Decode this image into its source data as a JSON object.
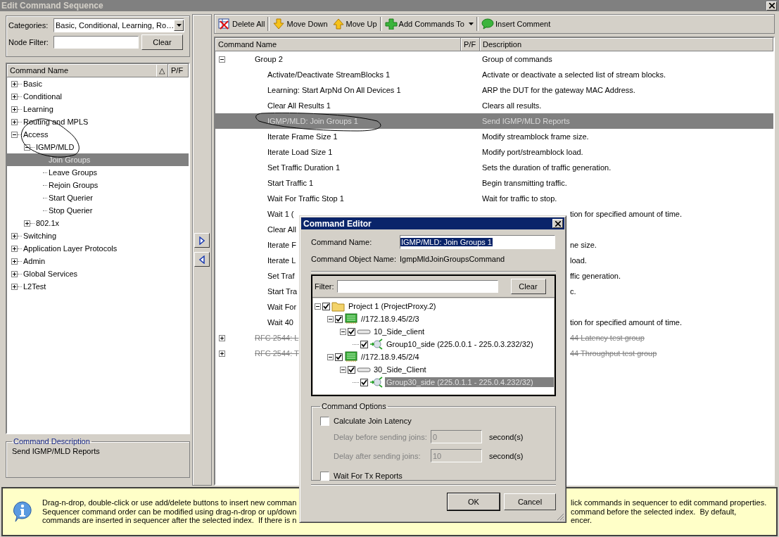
{
  "window": {
    "title": "Edit Command Sequence"
  },
  "filters": {
    "categories_label": "Categories:",
    "categories_value": "Basic, Conditional, Learning, Ro…",
    "node_filter_label": "Node Filter:",
    "clear": "Clear"
  },
  "command_tree": {
    "columns": [
      "Command Name",
      "P/F"
    ],
    "sort_mark": "△",
    "items": [
      {
        "label": "Basic",
        "kind": "group",
        "expanded": false,
        "selected": false
      },
      {
        "label": "Conditional",
        "kind": "group",
        "expanded": false,
        "selected": false
      },
      {
        "label": "Learning",
        "kind": "group",
        "expanded": false,
        "selected": false
      },
      {
        "label": "Routing and MPLS",
        "kind": "group",
        "expanded": false,
        "selected": false
      },
      {
        "label": "Access",
        "kind": "group",
        "expanded": true,
        "selected": false,
        "children": [
          {
            "label": "IGMP/MLD",
            "kind": "group",
            "expanded": true,
            "selected": false,
            "children": [
              {
                "label": "Join Groups",
                "kind": "command",
                "selected": true
              },
              {
                "label": "Leave Groups",
                "kind": "command",
                "selected": false
              },
              {
                "label": "Rejoin Groups",
                "kind": "command",
                "selected": false
              },
              {
                "label": "Start Querier",
                "kind": "command",
                "selected": false
              },
              {
                "label": "Stop Querier",
                "kind": "command",
                "selected": false
              }
            ]
          },
          {
            "label": "802.1x",
            "kind": "group",
            "expanded": false,
            "selected": false
          }
        ]
      },
      {
        "label": "Switching",
        "kind": "group",
        "expanded": false,
        "selected": false
      },
      {
        "label": "Application Layer Protocols",
        "kind": "group",
        "expanded": false,
        "selected": false
      },
      {
        "label": "Admin",
        "kind": "group",
        "expanded": false,
        "selected": false
      },
      {
        "label": "Global Services",
        "kind": "group",
        "expanded": false,
        "selected": false
      },
      {
        "label": "L2Test",
        "kind": "group",
        "expanded": false,
        "selected": false
      }
    ]
  },
  "command_description": {
    "title": "Command Description",
    "text": "Send IGMP/MLD Reports"
  },
  "toolbar": [
    {
      "label": "Delete All",
      "kind": "delete",
      "dropdown": false
    },
    {
      "label": "Move Down",
      "kind": "down",
      "dropdown": false
    },
    {
      "label": "Move Up",
      "kind": "up",
      "dropdown": false
    },
    {
      "label": "Add Commands To",
      "kind": "add",
      "dropdown": true
    },
    {
      "label": "Insert Comment",
      "kind": "comment",
      "dropdown": false
    }
  ],
  "sequence": {
    "columns": [
      "Command Name",
      "P/F",
      "Description"
    ],
    "rows": [
      {
        "name": "Group 2",
        "description": "Group of commands",
        "kind": "full",
        "expanded": true,
        "disabled": false,
        "selected": false,
        "children": [
          {
            "name": "Activate/Deactivate StreamBlocks 1",
            "description": "Activate or deactivate a selected list of stream blocks.",
            "kind": "full",
            "selected": false
          },
          {
            "name": "Learning: Start ArpNd On All Devices 1",
            "description": "ARP the DUT for the gateway MAC Address.",
            "kind": "full",
            "selected": false
          },
          {
            "name": "Clear All Results 1",
            "description": "Clears all results.",
            "kind": "full",
            "selected": false
          },
          {
            "name": "IGMP/MLD: Join Groups 1",
            "description": "Send IGMP/MLD Reports",
            "kind": "full",
            "selected": true
          },
          {
            "name": "Iterate Frame Size 1",
            "description": "Modify streamblock frame size.",
            "kind": "full",
            "selected": false
          },
          {
            "name": "Iterate Load Size 1",
            "description": "Modify port/streamblock load.",
            "kind": "full",
            "selected": false
          },
          {
            "name": "Set Traffic Duration 1",
            "description": "Sets the duration of traffic generation.",
            "kind": "full",
            "selected": false
          },
          {
            "name": "Start Traffic 1",
            "description": "Begin transmitting traffic.",
            "kind": "full",
            "selected": false
          },
          {
            "name": "Wait For Traffic Stop 1",
            "description": "Wait for traffic to stop.",
            "kind": "full",
            "selected": false
          },
          {
            "name": "Wait 1 (",
            "description": "tion for specified amount of time.",
            "kind": "clipped",
            "selected": false
          },
          {
            "name": "Clear All",
            "kind": "clipped",
            "selected": false
          },
          {
            "name": "Iterate F",
            "description": "ne size.",
            "kind": "clipped",
            "selected": false
          },
          {
            "name": "Iterate L",
            "description": "load.",
            "kind": "clipped",
            "selected": false
          },
          {
            "name": "Set Traf",
            "description": "ffic generation.",
            "kind": "clipped",
            "selected": false
          },
          {
            "name": "Start Tra",
            "description": "c.",
            "kind": "clipped",
            "selected": false
          },
          {
            "name": "Wait For",
            "kind": "clipped",
            "selected": false
          },
          {
            "name": "Wait 40",
            "description": "tion for specified amount of time.",
            "kind": "clipped",
            "selected": false
          }
        ]
      },
      {
        "name": "RFC 2544: L",
        "description": "44 Latency test group",
        "kind": "clipped",
        "expanded": false,
        "disabled": true,
        "selected": false
      },
      {
        "name": "RFC 2544: T",
        "description": "44 Throughput test group",
        "kind": "clipped",
        "expanded": false,
        "disabled": true,
        "selected": false
      }
    ]
  },
  "info": {
    "lines_left": [
      "Drag-n-drop, double-click or use add/delete buttons to insert new comman",
      "Sequencer command order can be modified using drag-n-drop or up/down",
      "commands are inserted in sequencer after the selected index.  If there is n"
    ],
    "lines_right": [
      "lick commands in sequencer to edit command properties.",
      "command before the selected index.  By default,",
      "encer."
    ]
  },
  "dialog": {
    "title": "Command Editor",
    "name_label": "Command Name:",
    "name_value": "IGMP/MLD: Join Groups 1",
    "object_label": "Command Object Name:",
    "object_value": "IgmpMldJoinGroupsCommand",
    "filter_label": "Filter:",
    "clear": "Clear",
    "tree": [
      {
        "label": "Project 1 (ProjectProxy.2)",
        "kind": "project",
        "checked": true,
        "expanded": true,
        "selected": false,
        "children": [
          {
            "label": "//172.18.9.45/2/3",
            "kind": "port",
            "checked": true,
            "expanded": true,
            "selected": false,
            "children": [
              {
                "label": "10_Side_client",
                "kind": "device",
                "checked": true,
                "expanded": true,
                "selected": false,
                "children": [
                  {
                    "label": "Group10_side (225.0.0.1 - 225.0.3.232/32)",
                    "kind": "group",
                    "checked": true,
                    "selected": false
                  }
                ]
              }
            ]
          },
          {
            "label": "//172.18.9.45/2/4",
            "kind": "port",
            "checked": true,
            "expanded": true,
            "selected": false,
            "children": [
              {
                "label": "30_Side_Client",
                "kind": "device",
                "checked": true,
                "expanded": true,
                "selected": false,
                "children": [
                  {
                    "label": "Group30_side (225.0.1.1 - 225.0.4.232/32)",
                    "kind": "group",
                    "checked": true,
                    "selected": true
                  }
                ]
              }
            ]
          }
        ]
      }
    ],
    "options_title": "Command Options",
    "calc_latency": {
      "label": "Calculate Join Latency",
      "checked": false
    },
    "delays": [
      {
        "label": "Delay before sending joins:",
        "value": "0",
        "unit": "second(s)",
        "disabled": true
      },
      {
        "label": "Delay after sending joins:",
        "value": "10",
        "unit": "second(s)",
        "disabled": true
      }
    ],
    "wait_tx": {
      "label": "Wait For Tx Reports",
      "checked": false
    },
    "buttons": [
      "OK",
      "Cancel"
    ]
  }
}
